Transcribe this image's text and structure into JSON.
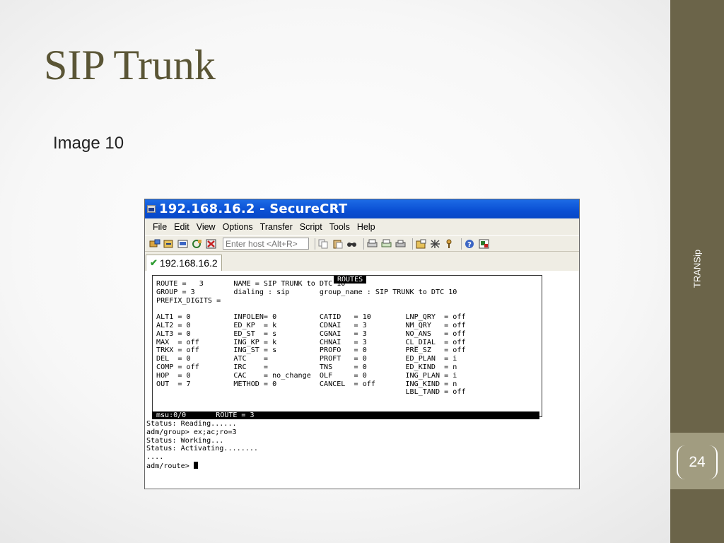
{
  "slide": {
    "title": "SIP Trunk",
    "subtitle": "Image 10",
    "side_label": "TRANSip",
    "page_number": "24"
  },
  "window": {
    "title": "192.168.16.2 - SecureCRT",
    "menu": [
      "File",
      "Edit",
      "View",
      "Options",
      "Transfer",
      "Script",
      "Tools",
      "Help"
    ],
    "host_placeholder": "Enter host <Alt+R>",
    "tab_label": "192.168.16.2"
  },
  "terminal": {
    "box_title": "ROUTES",
    "route_lines": [
      "ROUTE =   3       NAME = SIP TRUNK to DTC 10",
      "GROUP = 3         dialing : sip       group_name : SIP TRUNK to DTC 10",
      "PREFIX_DIGITS =",
      "",
      "ALT1 = 0          INFOLEN= 0          CATID   = 10        LNP_QRY  = off",
      "ALT2 = 0          ED_KP  = k          CDNAI   = 3         NM_QRY   = off",
      "ALT3 = 0          ED_ST  = s          CGNAI   = 3         NO_ANS   = off",
      "MAX  = off        ING_KP = k          CHNAI   = 3         CL_DIAL  = off",
      "TRKX = off        ING_ST = s          PROFO   = 0         PRE_SZ   = off",
      "DEL  = 0          ATC    =            PROFT   = 0         ED_PLAN  = i",
      "COMP = off        IRC    =            TNS     = 0         ED_KIND  = n",
      "HOP  = 0          CAC    = no_change  OLF     = 0         ING_PLAN = i",
      "OUT  = 7          METHOD = 0          CANCEL  = off       ING_KIND = n",
      "                                                          LBL_TAND = off"
    ],
    "status_bar": " msu:0/0       ROUTE = 3",
    "log_lines": [
      "Status: Reading......",
      "adm/group> ex;ac;ro=3",
      "Status: Working...",
      "Status: Activating........",
      "....",
      "adm/route> "
    ]
  },
  "colors": {
    "sidebar": "#6b6449",
    "page_block": "#a19c80",
    "title_color": "#5a5535",
    "titlebar_blue": "#0a4fd3"
  }
}
